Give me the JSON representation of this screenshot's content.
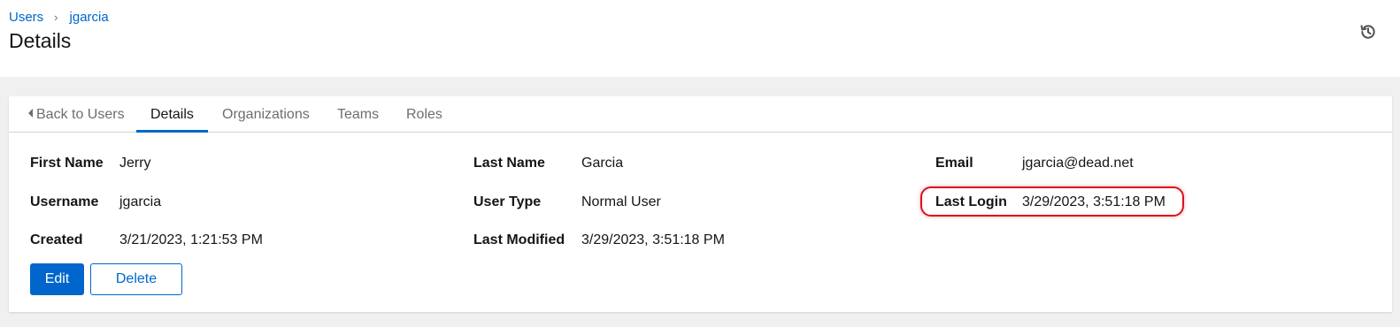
{
  "breadcrumb": {
    "items": [
      "Users",
      "jgarcia"
    ],
    "separator": "›"
  },
  "page": {
    "title": "Details",
    "history_icon": "history-icon"
  },
  "tabs": {
    "back": "Back to Users",
    "items": [
      "Details",
      "Organizations",
      "Teams",
      "Roles"
    ],
    "active": "Details"
  },
  "fields": {
    "first_name": {
      "label": "First Name",
      "value": "Jerry"
    },
    "username": {
      "label": "Username",
      "value": "jgarcia"
    },
    "created": {
      "label": "Created",
      "value": "3/21/2023, 1:21:53 PM"
    },
    "last_name": {
      "label": "Last Name",
      "value": "Garcia"
    },
    "user_type": {
      "label": "User Type",
      "value": "Normal User"
    },
    "last_modified": {
      "label": "Last Modified",
      "value": "3/29/2023, 3:51:18 PM"
    },
    "email": {
      "label": "Email",
      "value": "jgarcia@dead.net"
    },
    "last_login": {
      "label": "Last Login",
      "value": "3/29/2023, 3:51:18 PM"
    }
  },
  "actions": {
    "edit_label": "Edit",
    "delete_label": "Delete"
  },
  "colors": {
    "accent": "#0066cc",
    "highlight": "#e0101a"
  }
}
